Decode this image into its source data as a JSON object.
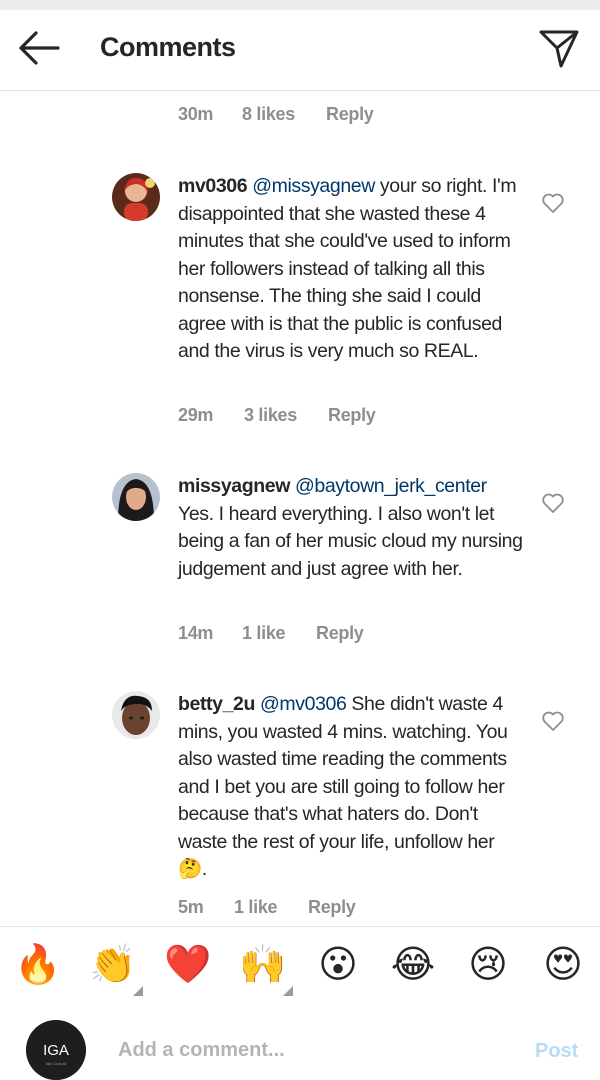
{
  "header": {
    "title": "Comments"
  },
  "top_comment": {
    "time": "30m",
    "likes": "8 likes",
    "reply": "Reply"
  },
  "comments": [
    {
      "username": "mv0306",
      "mention": "@missyagnew",
      "text": " your so right. I'm disappointed that she wasted these 4 minutes that she could've used to inform her followers instead of talking all this nonsense. The thing she said I could agree with is that the public is confused and the virus is very much so REAL.",
      "time": "29m",
      "likes": "3 likes",
      "reply": "Reply"
    },
    {
      "username": "missyagnew",
      "mention": "@baytown_jerk_center",
      "text": " Yes.  I heard everything.  I also won't let being a fan of her music cloud my nursing judgement and just agree with her.",
      "time": "14m",
      "likes": "1 like",
      "reply": "Reply"
    },
    {
      "username": "betty_2u",
      "mention": "@mv0306",
      "text": " She didn't waste 4 mins, you wasted 4 mins. watching. You also wasted time reading the comments and I bet you are still going to follow her because that's what haters do. Don't waste the rest of your life, unfollow her",
      "emoji": "🤔",
      "trail": ".",
      "time": "5m",
      "likes": "1 like",
      "reply": "Reply"
    }
  ],
  "emoji_bar": [
    "🔥",
    "👏",
    "❤️",
    "🙌",
    "😮",
    "😂",
    "😢",
    "😍"
  ],
  "composer": {
    "placeholder": "Add a comment...",
    "post_label": "Post",
    "avatar_text": "IGA",
    "avatar_subtext": "Ida Cook AI"
  },
  "colors": {
    "mention": "#00376b",
    "meta": "#8e8e8e",
    "post": "#b9dcf6"
  }
}
